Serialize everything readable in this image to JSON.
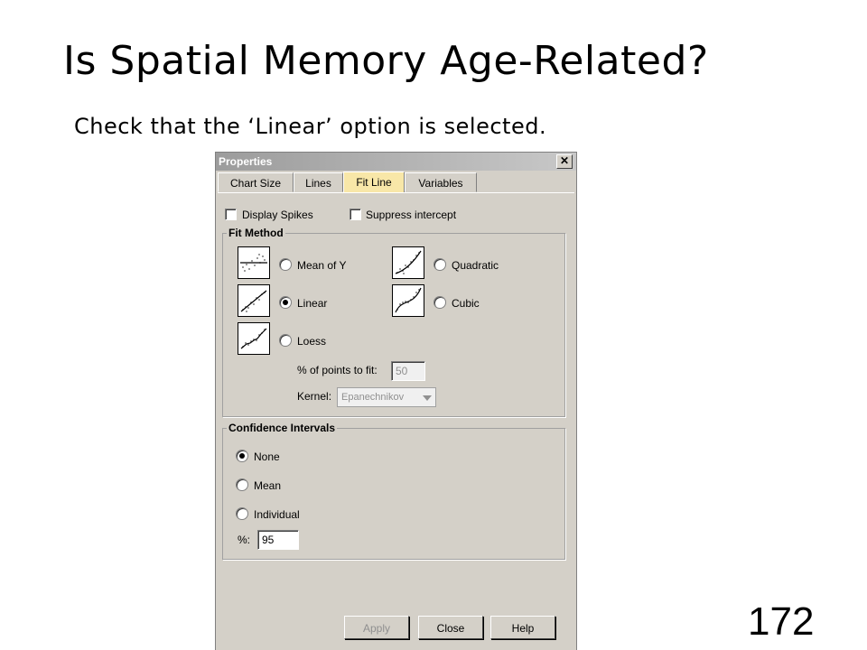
{
  "slide": {
    "title": "Is Spatial Memory Age-Related?",
    "subtitle": "Check that the ‘Linear’ option is selected.",
    "page_number": "172"
  },
  "dialog": {
    "title": "Properties",
    "close_glyph": "✕",
    "tabs": [
      {
        "label": "Chart Size",
        "active": false
      },
      {
        "label": "Lines",
        "active": false
      },
      {
        "label": "Fit Line",
        "active": true
      },
      {
        "label": "Variables",
        "active": false
      }
    ],
    "display_spikes": {
      "label": "Display Spikes",
      "checked": false
    },
    "suppress_intercept": {
      "label": "Suppress intercept",
      "checked": false
    },
    "fit_method": {
      "title": "Fit Method",
      "options": {
        "mean_of_y": {
          "label": "Mean of Y",
          "selected": false
        },
        "quadratic": {
          "label": "Quadratic",
          "selected": false
        },
        "linear": {
          "label": "Linear",
          "selected": true
        },
        "cubic": {
          "label": "Cubic",
          "selected": false
        },
        "loess": {
          "label": "Loess",
          "selected": false
        }
      },
      "points_to_fit_label": "% of points to fit:",
      "points_to_fit_value": "50",
      "kernel_label": "Kernel:",
      "kernel_value": "Epanechnikov"
    },
    "confidence_intervals": {
      "title": "Confidence Intervals",
      "options": {
        "none": {
          "label": "None",
          "selected": true
        },
        "mean": {
          "label": "Mean",
          "selected": false
        },
        "individual": {
          "label": "Individual",
          "selected": false
        }
      },
      "percent_label": "%:",
      "percent_value": "95"
    },
    "buttons": {
      "apply": "Apply",
      "close": "Close",
      "help": "Help"
    }
  },
  "colors": {
    "dialog_face": "#d4d0c8",
    "active_tab": "#f8e7a8",
    "titlebar": "#9c9c9c"
  }
}
